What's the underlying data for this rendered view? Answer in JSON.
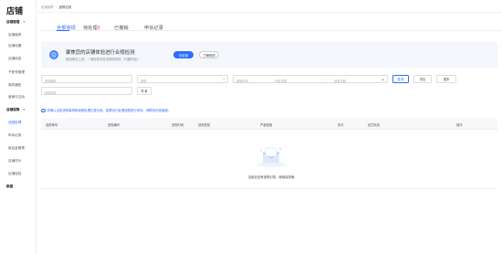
{
  "sidebar": {
    "logo": "店铺",
    "groups": [
      {
        "label": "店铺管理",
        "items": [
          "店铺装修",
          "店铺设置",
          "店铺信息",
          "子账号管理",
          "商机通知",
          "营销与互动"
        ]
      },
      {
        "label": "店铺保障",
        "items": [
          "违规处理",
          "申诉记录",
          "保证金管理",
          "店铺评分",
          "店铺巡检"
        ]
      },
      {
        "label": "数据",
        "items": []
      }
    ]
  },
  "breadcrumb": {
    "parent": "店铺保障",
    "separator": ">",
    "current": "违规记录"
  },
  "tabs": [
    {
      "label": "全部违规",
      "active": true,
      "count": ""
    },
    {
      "label": "待处理",
      "active": false,
      "count": "0"
    },
    {
      "label": "已撤销",
      "active": false,
      "count": ""
    },
    {
      "label": "申诉记录",
      "active": false,
      "count": ""
    }
  ],
  "banner": {
    "title": "聚焦您的店铺体验进行合规检测",
    "subtitle": "使用体检工具，一键检查存在违规风险的「问题商品」",
    "primary_button": "去检测",
    "secondary_button": "了解规则"
  },
  "filters": {
    "violation_id": "违规编号",
    "violation_type": "违规",
    "violation_time": "违规时间",
    "start_date": "开始日期",
    "end_date": "结束日期",
    "product_id": "违规商品",
    "search_button": "搜 索",
    "reset_button": "重 置",
    "export_button": "导出",
    "more_button": "更多"
  },
  "notice": "说明以当前违规事项和违规处理记录为准，如需对已处理违规进行申诉，请联系在线客服。",
  "table": {
    "columns": [
      "违规单号",
      "违规编号",
      "违规时间",
      "违规类型",
      "严重程度",
      "扣分",
      "处罚状态",
      "操作"
    ],
    "empty_text": "当前还没有违规记录，继续保持哦"
  },
  "colors": {
    "accent": "#2f6bff",
    "banner_bg": "#f3f6fb",
    "badge_red": "#f04134"
  }
}
